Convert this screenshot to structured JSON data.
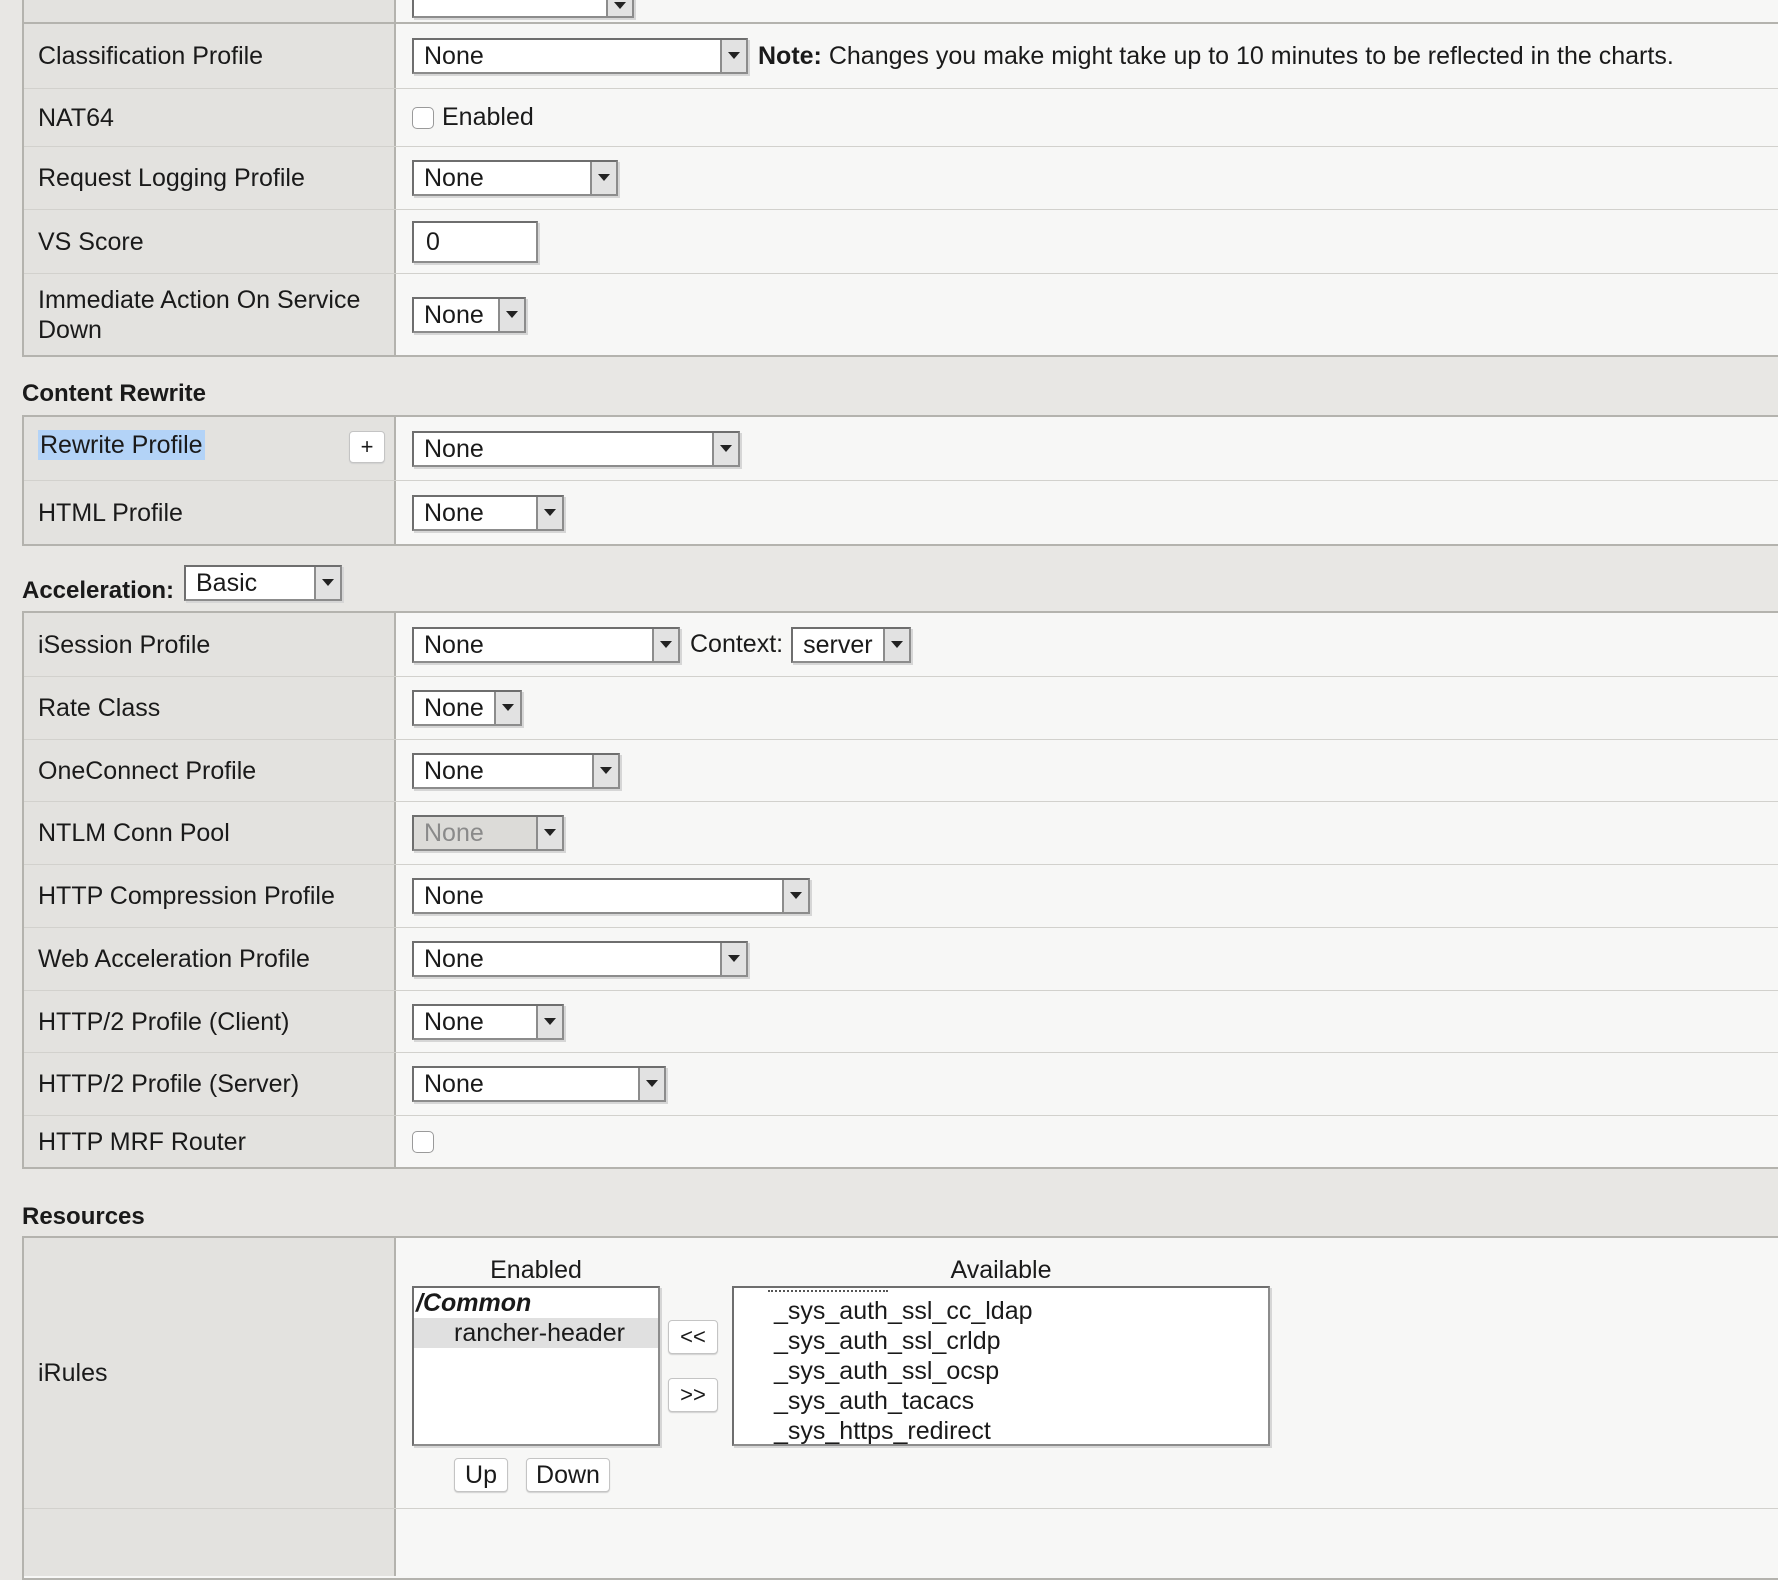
{
  "top_rows": {
    "classification_profile": {
      "label": "Classification Profile",
      "value": "None",
      "note_bold": "Note:",
      "note_text": "Changes you make might take up to 10 minutes to be reflected in the charts."
    },
    "nat64": {
      "label": "NAT64",
      "checkbox_label": "Enabled"
    },
    "request_logging_profile": {
      "label": "Request Logging Profile",
      "value": "None"
    },
    "vs_score": {
      "label": "VS Score",
      "value": "0"
    },
    "immediate_action": {
      "label": "Immediate Action On Service Down",
      "value": "None"
    }
  },
  "content_rewrite": {
    "heading": "Content Rewrite",
    "rewrite_profile": {
      "label": "Rewrite Profile",
      "add_button": "+",
      "value": "None"
    },
    "html_profile": {
      "label": "HTML Profile",
      "value": "None"
    }
  },
  "acceleration": {
    "heading": "Acceleration:",
    "mode": "Basic",
    "isession_profile": {
      "label": "iSession Profile",
      "value": "None",
      "context_label": "Context:",
      "context_value": "server"
    },
    "rate_class": {
      "label": "Rate Class",
      "value": "None"
    },
    "oneconnect_profile": {
      "label": "OneConnect Profile",
      "value": "None"
    },
    "ntlm_conn_pool": {
      "label": "NTLM Conn Pool",
      "value": "None"
    },
    "http_compression_profile": {
      "label": "HTTP Compression Profile",
      "value": "None"
    },
    "web_acceleration_profile": {
      "label": "Web Acceleration Profile",
      "value": "None"
    },
    "http2_client": {
      "label": "HTTP/2 Profile (Client)",
      "value": "None"
    },
    "http2_server": {
      "label": "HTTP/2 Profile (Server)",
      "value": "None"
    },
    "http_mrf_router": {
      "label": "HTTP MRF Router"
    }
  },
  "resources": {
    "heading": "Resources",
    "irules": {
      "label": "iRules",
      "enabled_header": "Enabled",
      "available_header": "Available",
      "enabled_group": "/Common",
      "enabled_items": [
        "rancher-header"
      ],
      "available_items": [
        "_sys_auth_ssl_cc_ldap",
        "_sys_auth_ssl_crldp",
        "_sys_auth_ssl_ocsp",
        "_sys_auth_tacacs",
        "_sys_https_redirect"
      ],
      "move_left_button": "<<",
      "move_right_button": ">>",
      "up_button": "Up",
      "down_button": "Down"
    }
  },
  "colors": {
    "page_bg": "#e8e7e4",
    "label_bg": "#e3e2df",
    "value_bg": "#f7f7f6",
    "highlight": "#b3d3f7"
  }
}
